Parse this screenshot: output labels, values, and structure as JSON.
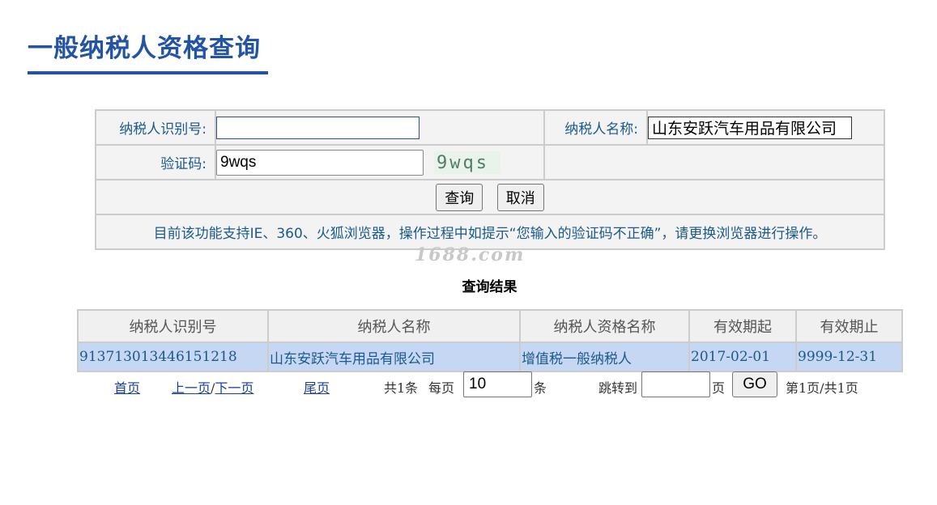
{
  "page": {
    "title": "一般纳税人资格查询"
  },
  "form": {
    "taxpayer_id_label": "纳税人识别号:",
    "taxpayer_id_value": "",
    "taxpayer_name_label": "纳税人名称:",
    "taxpayer_name_value": "山东安跃汽车用品有限公司",
    "captcha_label": "验证码:",
    "captcha_value": "9wqs",
    "captcha_image_text": "9wqs",
    "query_button": "查询",
    "cancel_button": "取消",
    "notice": "目前该功能支持IE、360、火狐浏览器，操作过程中如提示“您输入的验证码不正确”，请更换浏览器进行操作。"
  },
  "watermark": "1688.com",
  "results": {
    "title": "查询结果",
    "columns": [
      "纳税人识别号",
      "纳税人名称",
      "纳税人资格名称",
      "有效期起",
      "有效期止"
    ],
    "rows": [
      [
        "913713013446151218",
        "山东安跃汽车用品有限公司",
        "增值税一般纳税人",
        "2017-02-01",
        "9999-12-31"
      ]
    ]
  },
  "pager": {
    "first": "首页",
    "prev": "上一页",
    "separator": "/",
    "next": "下一页",
    "last": "尾页",
    "total": "共1条",
    "per_page_label": "每页",
    "per_page_value": "10",
    "per_page_unit": "条",
    "jump_label": "跳转到",
    "jump_value": "",
    "jump_unit": "页",
    "go_button": "GO",
    "page_info": "第1页/共1页"
  },
  "colors": {
    "accent": "#2353a3",
    "link": "#1b3fa0",
    "row_highlight": "#c5d7f3"
  }
}
